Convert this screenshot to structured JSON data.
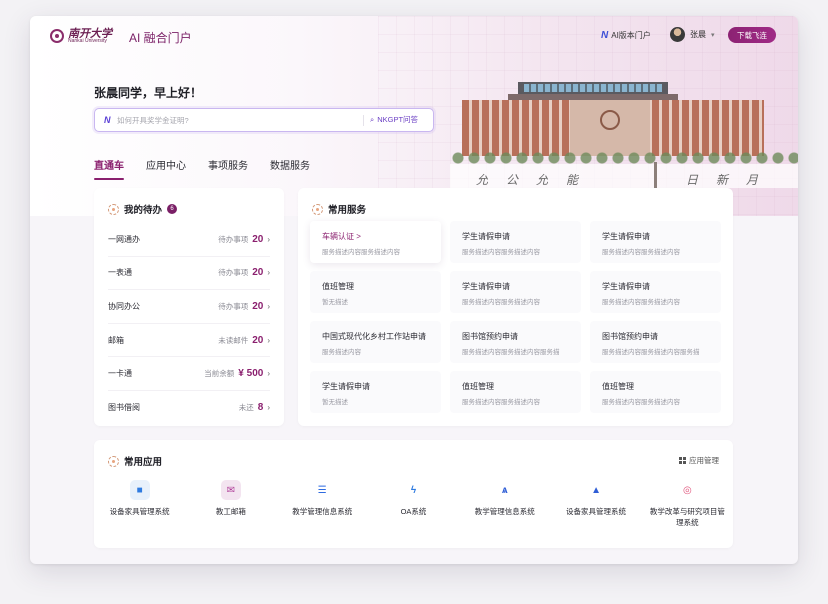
{
  "header": {
    "logo_cn": "南开大学",
    "logo_en": "Nankai University",
    "portal_title": "AI 融合门户",
    "ai_portal_label": "AI版本门户",
    "user_name": "张晨",
    "download_label": "下载飞连"
  },
  "hero": {
    "greeting": "张晨同学，早上好！",
    "search_placeholder": "如何开具奖学金证明?",
    "search_button": "NKGPT问答",
    "motto_left": "允公允能",
    "motto_right": "日新月异"
  },
  "tabs": [
    {
      "label": "直通车",
      "active": true
    },
    {
      "label": "应用中心",
      "active": false
    },
    {
      "label": "事项服务",
      "active": false
    },
    {
      "label": "数据服务",
      "active": false
    }
  ],
  "todo": {
    "title": "我的待办",
    "badge": "6",
    "items": [
      {
        "name": "一网通办",
        "label": "待办事项",
        "value": "20"
      },
      {
        "name": "一表通",
        "label": "待办事项",
        "value": "20"
      },
      {
        "name": "协同办公",
        "label": "待办事项",
        "value": "20"
      },
      {
        "name": "邮箱",
        "label": "未读邮件",
        "value": "20"
      },
      {
        "name": "一卡通",
        "label": "当前余额",
        "value": "¥ 500"
      },
      {
        "name": "图书借阅",
        "label": "未还",
        "value": "8"
      }
    ]
  },
  "services": {
    "title": "常用服务",
    "items": [
      {
        "name": "车辆认证 >",
        "desc": "服务描述内容服务描述内容",
        "highlight": true
      },
      {
        "name": "学生请假申请",
        "desc": "服务描述内容服务描述内容"
      },
      {
        "name": "学生请假申请",
        "desc": "服务描述内容服务描述内容"
      },
      {
        "name": "值班管理",
        "desc": "暂无描述"
      },
      {
        "name": "学生请假申请",
        "desc": "服务描述内容服务描述内容"
      },
      {
        "name": "学生请假申请",
        "desc": "服务描述内容服务描述内容"
      },
      {
        "name": "中国式现代化乡村工作站申请",
        "desc": "服务描述内容"
      },
      {
        "name": "图书馆预约申请",
        "desc": "服务描述内容服务描述内容服务描"
      },
      {
        "name": "图书馆预约申请",
        "desc": "服务描述内容服务描述内容服务描"
      },
      {
        "name": "学生请假申请",
        "desc": "暂无描述"
      },
      {
        "name": "值班管理",
        "desc": "服务描述内容服务描述内容"
      },
      {
        "name": "值班管理",
        "desc": "服务描述内容服务描述内容"
      }
    ]
  },
  "apps": {
    "title": "常用应用",
    "manage_label": "应用管理",
    "items": [
      {
        "name": "设备家具管理系统",
        "icon": "video-camera-icon",
        "glyph": "■",
        "bg": "#e8f1fb",
        "color": "#2f7be0"
      },
      {
        "name": "教工邮箱",
        "icon": "mail-icon",
        "glyph": "✉",
        "bg": "#f3e4f0",
        "color": "#b0409a"
      },
      {
        "name": "教学管理信息系统",
        "icon": "list-icon",
        "glyph": "☰",
        "bg": "#ffffff",
        "color": "#2f6be0"
      },
      {
        "name": "OA系统",
        "icon": "oa-icon",
        "glyph": "ϟ",
        "bg": "#ffffff",
        "color": "#2f7be0"
      },
      {
        "name": "教学管理信息系统",
        "icon": "people-icon",
        "glyph": "ѧ",
        "bg": "#ffffff",
        "color": "#2f5ed6"
      },
      {
        "name": "设备家具管理系统",
        "icon": "triangle-icon",
        "glyph": "▲",
        "bg": "#ffffff",
        "color": "#2f5ed6"
      },
      {
        "name": "教学改革与研究项目管理系统",
        "icon": "colorful-icon",
        "glyph": "◎",
        "bg": "#ffffff",
        "color": "#e0527a"
      }
    ]
  }
}
